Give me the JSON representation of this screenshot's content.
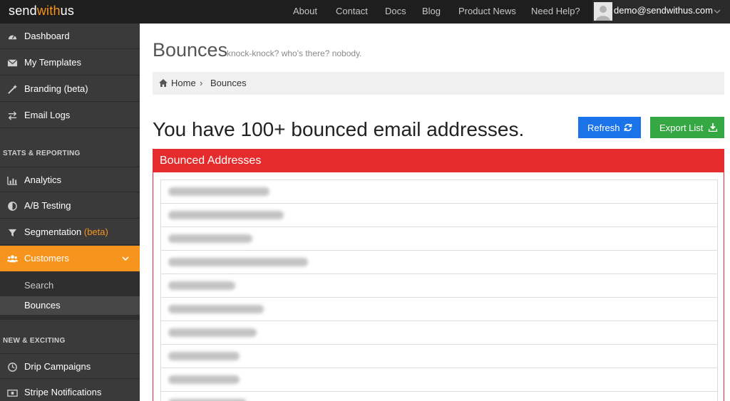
{
  "brand": {
    "prefix": "send",
    "accent": "with",
    "suffix": "us",
    "accent_color": "#f7941d"
  },
  "topnav": {
    "items": [
      "About",
      "Contact",
      "Docs",
      "Blog",
      "Product News",
      "Need Help?"
    ],
    "user_email": "demo@sendwithus.com"
  },
  "sidebar": {
    "main_items": [
      "Dashboard",
      "My Templates",
      "Branding (beta)",
      "Email Logs"
    ],
    "stats_heading": "STATS & REPORTING",
    "stats_items": [
      "Analytics",
      "A/B Testing",
      "Segmentation"
    ],
    "segmentation_beta": "(beta)",
    "customers_label": "Customers",
    "customers_sub": [
      "Search",
      "Bounces"
    ],
    "new_heading": "NEW & EXCITING",
    "new_items": [
      "Drip Campaigns",
      "Stripe Notifications"
    ]
  },
  "page": {
    "title": "Bounces",
    "subtitle": "knock-knock? who's there? nobody.",
    "breadcrumb": {
      "home": "Home",
      "separator": "›",
      "current": "Bounces"
    },
    "headline": "You have 100+ bounced email addresses.",
    "refresh_label": "Refresh",
    "export_label": "Export List",
    "panel_title": "Bounced Addresses",
    "colors": {
      "refresh": "#1a73e8",
      "export": "#35a844",
      "panel": "#e52b2b"
    }
  }
}
